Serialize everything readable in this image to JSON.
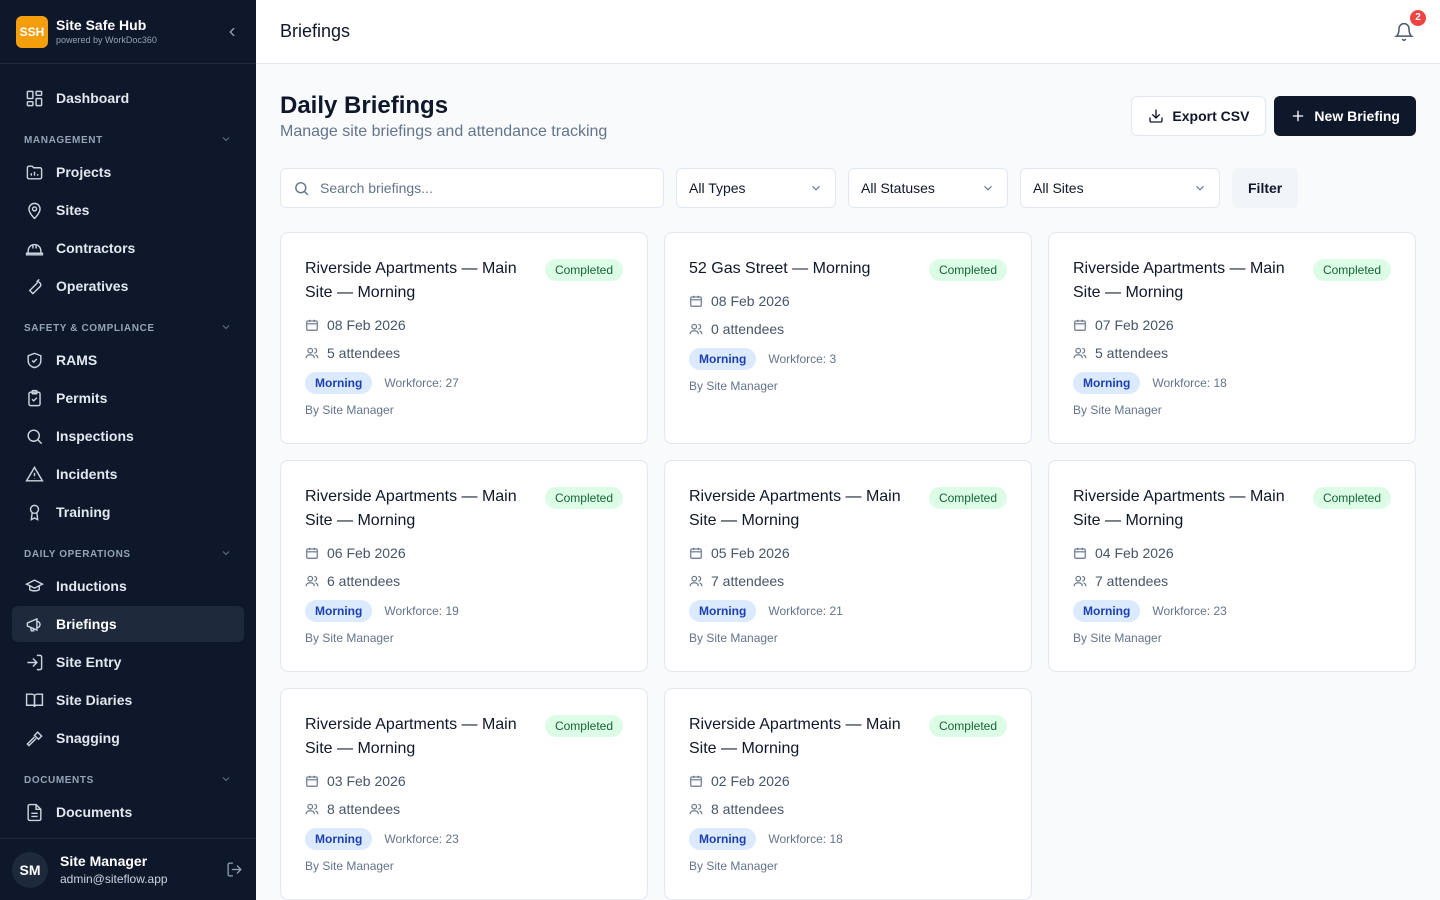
{
  "brand": {
    "logo": "SSH",
    "name": "Site Safe Hub",
    "sub": "powered by WorkDoc360"
  },
  "nav": {
    "dashboard": "Dashboard",
    "sections": {
      "management": "MANAGEMENT",
      "safety": "SAFETY & COMPLIANCE",
      "daily": "DAILY OPERATIONS",
      "documents": "DOCUMENTS"
    },
    "items": {
      "projects": "Projects",
      "sites": "Sites",
      "contractors": "Contractors",
      "operatives": "Operatives",
      "rams": "RAMS",
      "permits": "Permits",
      "inspections": "Inspections",
      "incidents": "Incidents",
      "training": "Training",
      "inductions": "Inductions",
      "briefings": "Briefings",
      "site_entry": "Site Entry",
      "site_diaries": "Site Diaries",
      "snagging": "Snagging",
      "documents": "Documents"
    }
  },
  "user": {
    "initials": "SM",
    "name": "Site Manager",
    "email": "admin@siteflow.app"
  },
  "topbar": {
    "title": "Briefings",
    "notifications": "2"
  },
  "page": {
    "title": "Daily Briefings",
    "subtitle": "Manage site briefings and attendance tracking",
    "export_label": "Export CSV",
    "new_label": "New Briefing"
  },
  "filters": {
    "search_placeholder": "Search briefings...",
    "type": "All Types",
    "status": "All Statuses",
    "site": "All Sites",
    "filter_label": "Filter"
  },
  "cards": [
    {
      "title": "Riverside Apartments — Main Site — Morning",
      "status": "Completed",
      "date": "08 Feb 2026",
      "attendees": "5 attendees",
      "shift": "Morning",
      "workforce": "Workforce: 27",
      "by": "By Site Manager"
    },
    {
      "title": "52 Gas Street — Morning",
      "status": "Completed",
      "date": "08 Feb 2026",
      "attendees": "0 attendees",
      "shift": "Morning",
      "workforce": "Workforce: 3",
      "by": "By Site Manager"
    },
    {
      "title": "Riverside Apartments — Main Site — Morning",
      "status": "Completed",
      "date": "07 Feb 2026",
      "attendees": "5 attendees",
      "shift": "Morning",
      "workforce": "Workforce: 18",
      "by": "By Site Manager"
    },
    {
      "title": "Riverside Apartments — Main Site — Morning",
      "status": "Completed",
      "date": "06 Feb 2026",
      "attendees": "6 attendees",
      "shift": "Morning",
      "workforce": "Workforce: 19",
      "by": "By Site Manager"
    },
    {
      "title": "Riverside Apartments — Main Site — Morning",
      "status": "Completed",
      "date": "05 Feb 2026",
      "attendees": "7 attendees",
      "shift": "Morning",
      "workforce": "Workforce: 21",
      "by": "By Site Manager"
    },
    {
      "title": "Riverside Apartments — Main Site — Morning",
      "status": "Completed",
      "date": "04 Feb 2026",
      "attendees": "7 attendees",
      "shift": "Morning",
      "workforce": "Workforce: 23",
      "by": "By Site Manager"
    },
    {
      "title": "Riverside Apartments — Main Site — Morning",
      "status": "Completed",
      "date": "03 Feb 2026",
      "attendees": "8 attendees",
      "shift": "Morning",
      "workforce": "Workforce: 23",
      "by": "By Site Manager"
    },
    {
      "title": "Riverside Apartments — Main Site — Morning",
      "status": "Completed",
      "date": "02 Feb 2026",
      "attendees": "8 attendees",
      "shift": "Morning",
      "workforce": "Workforce: 18",
      "by": "By Site Manager"
    }
  ],
  "colors": {
    "sidebar_bg": "#0f172a",
    "brand_accent": "#f59e0b",
    "status_completed_bg": "#dcfce7",
    "shift_bg": "#dbeafe",
    "badge": "#ef4444"
  },
  "icons": {
    "dashboard": "grid-icon",
    "projects": "folder-chart-icon",
    "sites": "map-pin-icon",
    "contractors": "hard-hat-icon",
    "operatives": "wrench-icon",
    "rams": "shield-check-icon",
    "permits": "clipboard-check-icon",
    "inspections": "search-icon",
    "incidents": "alert-triangle-icon",
    "training": "award-icon",
    "inductions": "graduation-cap-icon",
    "briefings": "megaphone-icon",
    "site_entry": "log-in-icon",
    "site_diaries": "book-open-icon",
    "snagging": "hammer-icon",
    "documents": "file-text-icon"
  }
}
